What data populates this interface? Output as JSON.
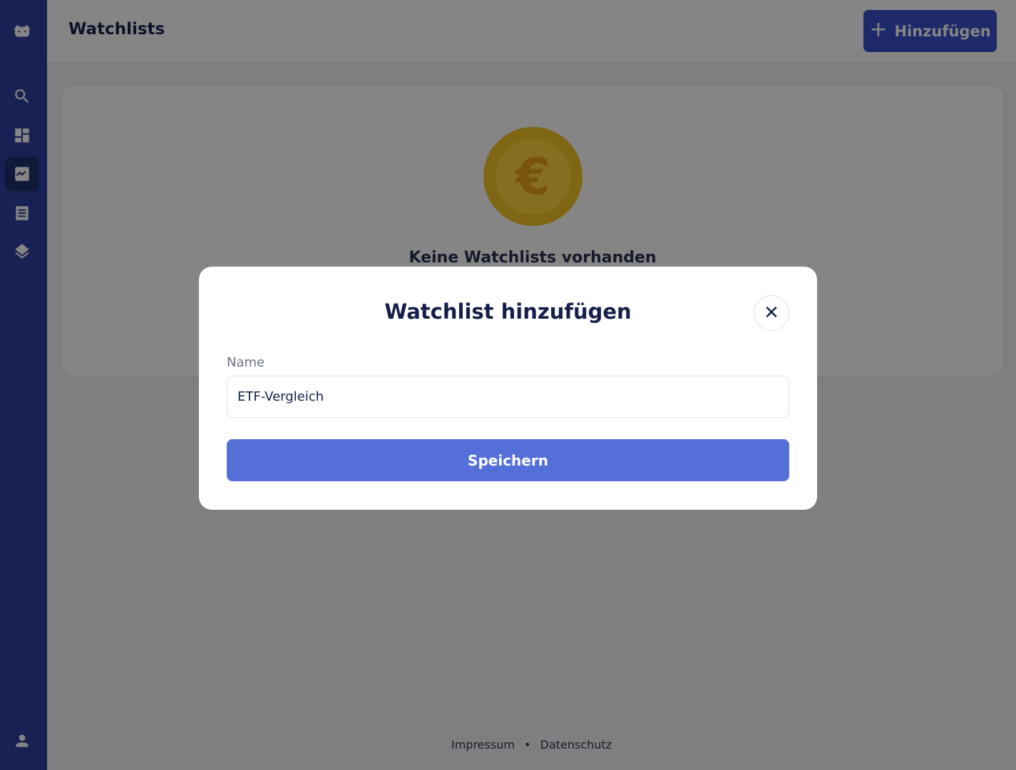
{
  "header": {
    "title": "Watchlists",
    "add_button_label": "Hinzufügen"
  },
  "sidebar": {
    "items": [
      {
        "name": "logo",
        "icon": "hippo-logo-icon"
      },
      {
        "name": "search",
        "icon": "search-icon"
      },
      {
        "name": "dashboard",
        "icon": "dashboard-icon"
      },
      {
        "name": "watchlists",
        "icon": "chart-icon",
        "active": true
      },
      {
        "name": "transactions",
        "icon": "list-icon"
      },
      {
        "name": "portfolios",
        "icon": "layers-icon"
      },
      {
        "name": "account",
        "icon": "person-icon"
      }
    ]
  },
  "empty_state": {
    "title": "Keine Watchlists vorhanden",
    "coin_symbol": "€"
  },
  "footer": {
    "impressum": "Impressum",
    "separator": "•",
    "datenschutz": "Datenschutz"
  },
  "modal": {
    "title": "Watchlist hinzufügen",
    "close_symbol": "✕",
    "name_label": "Name",
    "name_value": "ETF-Vergleich",
    "save_label": "Speichern"
  },
  "colors": {
    "sidebar": "#303f9f",
    "primary_button": "#3b4fc9",
    "save_button": "#5470d8",
    "coin": "#f3c32a"
  }
}
